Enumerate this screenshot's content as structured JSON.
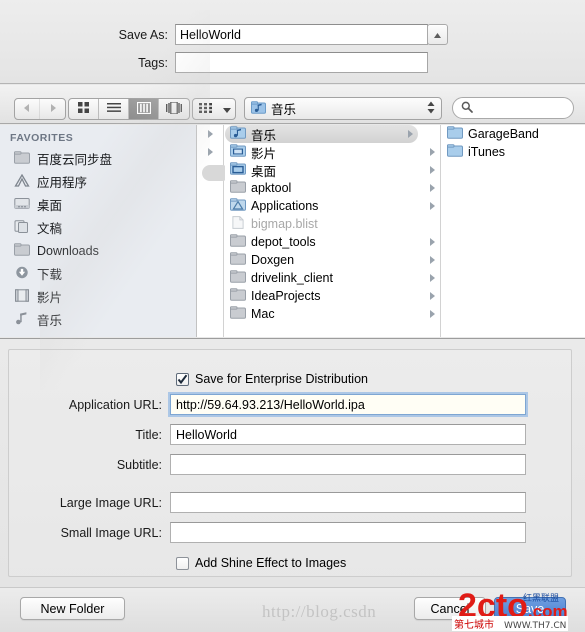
{
  "save_panel": {
    "save_as_label": "Save As:",
    "save_as_value": "HelloWorld",
    "tags_label": "Tags:",
    "tags_value": "",
    "tags_placeholder": "",
    "stepper_icon": "triangle-up-icon"
  },
  "toolbar": {
    "back_icon": "back-arrow-icon",
    "forward_icon": "forward-arrow-icon",
    "view_modes": [
      {
        "name": "icon-view",
        "icon": "grid-icon",
        "selected": false
      },
      {
        "name": "list-view",
        "icon": "list-icon",
        "selected": false
      },
      {
        "name": "column-view",
        "icon": "columns-icon",
        "selected": true
      },
      {
        "name": "coverflow-view",
        "icon": "coverflow-icon",
        "selected": false
      }
    ],
    "arrange_icon": "arrange-icon",
    "arrange_chevron": "chevron-down-icon",
    "path_label": "音乐",
    "path_icon": "music-folder-icon",
    "path_stepper_icon": "up-down-arrows-icon",
    "search_placeholder": "",
    "search_value": "",
    "search_icon": "search-icon"
  },
  "sidebar": {
    "header": "FAVORITES",
    "items": [
      {
        "label": "百度云同步盘",
        "icon": "folder-icon"
      },
      {
        "label": "应用程序",
        "icon": "applications-icon"
      },
      {
        "label": "桌面",
        "icon": "desktop-icon"
      },
      {
        "label": "文稿",
        "icon": "documents-icon"
      },
      {
        "label": "Downloads",
        "icon": "folder-icon"
      },
      {
        "label": "下载",
        "icon": "downloads-arrow-icon"
      },
      {
        "label": "影片",
        "icon": "movies-film-icon"
      },
      {
        "label": "音乐",
        "icon": "music-note-icon"
      }
    ]
  },
  "browser": {
    "column0_rows": [
      {
        "icon": "chevron-right-icon"
      },
      {
        "icon": "chevron-right-icon"
      },
      {
        "icon": "chevron-right-icon"
      }
    ],
    "column1_rows": [
      {
        "label": "音乐",
        "icon": "music-folder-icon",
        "selected": true,
        "has_children": true,
        "greyed": false
      },
      {
        "label": "影片",
        "icon": "movies-folder-icon",
        "selected": false,
        "has_children": true,
        "greyed": false
      },
      {
        "label": "桌面",
        "icon": "desktop-folder-icon",
        "selected": false,
        "has_children": true,
        "greyed": false
      },
      {
        "label": "apktool",
        "icon": "folder-icon",
        "selected": false,
        "has_children": true,
        "greyed": false
      },
      {
        "label": "Applications",
        "icon": "applications-folder-icon",
        "selected": false,
        "has_children": true,
        "greyed": false
      },
      {
        "label": "bigmap.blist",
        "icon": "document-icon",
        "selected": false,
        "has_children": false,
        "greyed": true
      },
      {
        "label": "depot_tools",
        "icon": "folder-icon",
        "selected": false,
        "has_children": true,
        "greyed": false
      },
      {
        "label": "Doxgen",
        "icon": "folder-icon",
        "selected": false,
        "has_children": true,
        "greyed": false
      },
      {
        "label": "drivelink_client",
        "icon": "folder-icon",
        "selected": false,
        "has_children": true,
        "greyed": false
      },
      {
        "label": "IdeaProjects",
        "icon": "folder-icon",
        "selected": false,
        "has_children": true,
        "greyed": false
      },
      {
        "label": "Mac",
        "icon": "folder-icon",
        "selected": false,
        "has_children": true,
        "greyed": false
      }
    ],
    "column2_rows": [
      {
        "label": "GarageBand",
        "icon": "folder-icon"
      },
      {
        "label": "iTunes",
        "icon": "folder-icon"
      }
    ]
  },
  "accessory": {
    "enterprise_checkbox": {
      "label": "Save for Enterprise Distribution",
      "checked": true
    },
    "fields": [
      {
        "label": "Application URL:",
        "value": "http://59.64.93.213/HelloWorld.ipa",
        "focused": true
      },
      {
        "label": "Title:",
        "value": "HelloWorld",
        "focused": false
      },
      {
        "label": "Subtitle:",
        "value": "",
        "focused": false
      },
      {
        "label": "Large Image URL:",
        "value": "",
        "focused": false
      },
      {
        "label": "Small Image URL:",
        "value": "",
        "focused": false
      }
    ],
    "shine_checkbox": {
      "label": "Add Shine Effect to Images",
      "checked": false
    }
  },
  "buttons": {
    "new_folder": "New Folder",
    "cancel": "Cancel",
    "save": "Save"
  },
  "watermarks": {
    "blog": "http://blog.csdn",
    "brand": "2cto",
    "brand_domain": ".com",
    "cn_name": "第七城市",
    "cn_site": "WWW.TH7.CN",
    "blue_text": "红黑联盟"
  },
  "colors": {
    "accent": "#4a7fd0",
    "focus_ring": "#7ea6d2",
    "watermark_red": "#e01b16",
    "sidebar_bg": "#e9ecf1"
  }
}
